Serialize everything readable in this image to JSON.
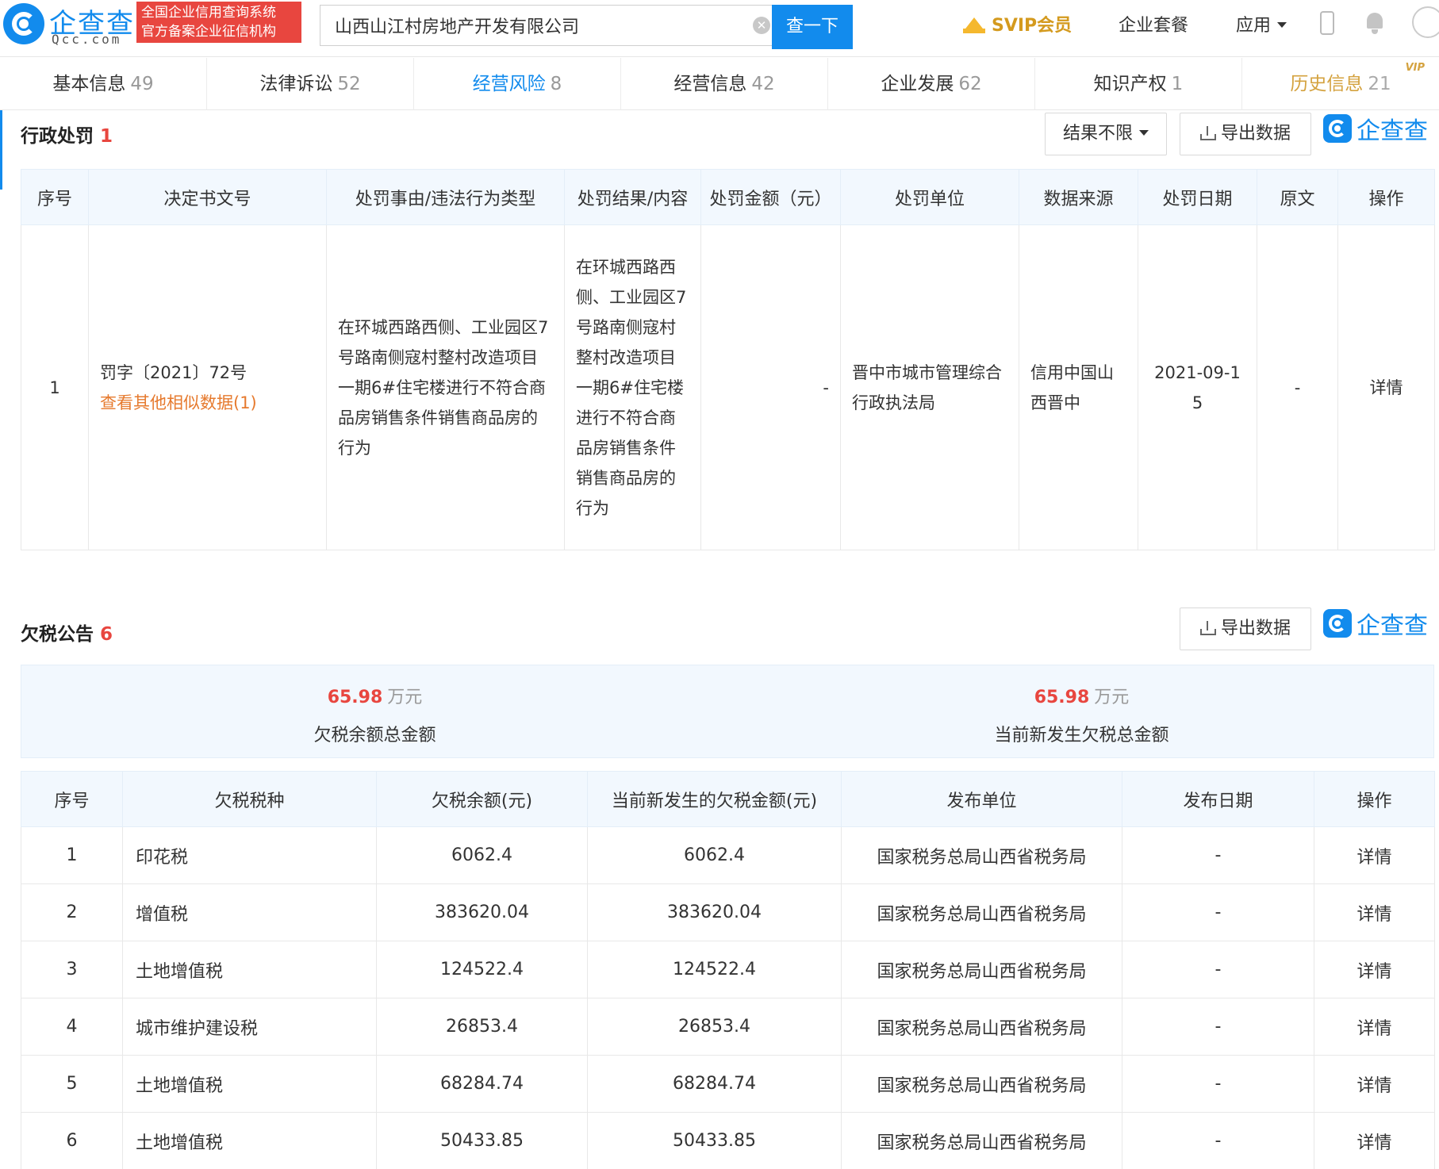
{
  "header": {
    "brand_name": "企查查",
    "brand_domain": "Qcc.com",
    "badge_line1": "全国企业信用查询系统",
    "badge_line2": "官方备案企业征信机构",
    "search_value": "山西山江村房地产开发有限公司",
    "search_button": "查一下",
    "svip": "SVIP会员",
    "package": "企业套餐",
    "apps": "应用"
  },
  "tabs": [
    {
      "label": "基本信息",
      "count": "49"
    },
    {
      "label": "法律诉讼",
      "count": "52"
    },
    {
      "label": "经营风险",
      "count": "8"
    },
    {
      "label": "经营信息",
      "count": "42"
    },
    {
      "label": "企业发展",
      "count": "62"
    },
    {
      "label": "知识产权",
      "count": "1"
    },
    {
      "label": "历史信息",
      "count": "21",
      "tag": "VIP"
    }
  ],
  "penalty": {
    "title": "行政处罚",
    "count": "1",
    "filter": "结果不限",
    "export": "导出数据",
    "watermark": "企查查",
    "columns": [
      "序号",
      "决定书文号",
      "处罚事由/违法行为类型",
      "处罚结果/内容",
      "处罚金额（元）",
      "处罚单位",
      "数据来源",
      "处罚日期",
      "原文",
      "操作"
    ],
    "row": {
      "index": "1",
      "doc_no": "罚字〔2021〕72号",
      "similar": "查看其他相似数据(1)",
      "reason": "在环城西路西侧、工业园区7号路南侧寇村整村改造项目一期6#住宅楼进行不符合商品房销售条件销售商品房的行为",
      "result": "在环城西路西侧、工业园区7号路南侧寇村整村改造项目一期6#住宅楼进行不符合商品房销售条件销售商品房的行为",
      "amount": "-",
      "unit": "晋中市城市管理综合行政执法局",
      "source": "信用中国山西晋中",
      "date": "2021-09-15",
      "original": "-",
      "action": "详情"
    }
  },
  "tax": {
    "title": "欠税公告",
    "count": "6",
    "export": "导出数据",
    "watermark": "企查查",
    "summary": [
      {
        "value": "65.98",
        "unit": "万元",
        "label": "欠税余额总金额"
      },
      {
        "value": "65.98",
        "unit": "万元",
        "label": "当前新发生欠税总金额"
      }
    ],
    "columns": [
      "序号",
      "欠税税种",
      "欠税余额(元)",
      "当前新发生的欠税金额(元)",
      "发布单位",
      "发布日期",
      "操作"
    ],
    "rows": [
      {
        "index": "1",
        "type": "印花税",
        "balance": "6062.4",
        "new": "6062.4",
        "unit": "国家税务总局山西省税务局",
        "date": "-",
        "action": "详情"
      },
      {
        "index": "2",
        "type": "增值税",
        "balance": "383620.04",
        "new": "383620.04",
        "unit": "国家税务总局山西省税务局",
        "date": "-",
        "action": "详情"
      },
      {
        "index": "3",
        "type": "土地增值税",
        "balance": "124522.4",
        "new": "124522.4",
        "unit": "国家税务总局山西省税务局",
        "date": "-",
        "action": "详情"
      },
      {
        "index": "4",
        "type": "城市维护建设税",
        "balance": "26853.4",
        "new": "26853.4",
        "unit": "国家税务总局山西省税务局",
        "date": "-",
        "action": "详情"
      },
      {
        "index": "5",
        "type": "土地增值税",
        "balance": "68284.74",
        "new": "68284.74",
        "unit": "国家税务总局山西省税务局",
        "date": "-",
        "action": "详情"
      },
      {
        "index": "6",
        "type": "土地增值税",
        "balance": "50433.85",
        "new": "50433.85",
        "unit": "国家税务总局山西省税务局",
        "date": "-",
        "action": "详情"
      }
    ]
  }
}
